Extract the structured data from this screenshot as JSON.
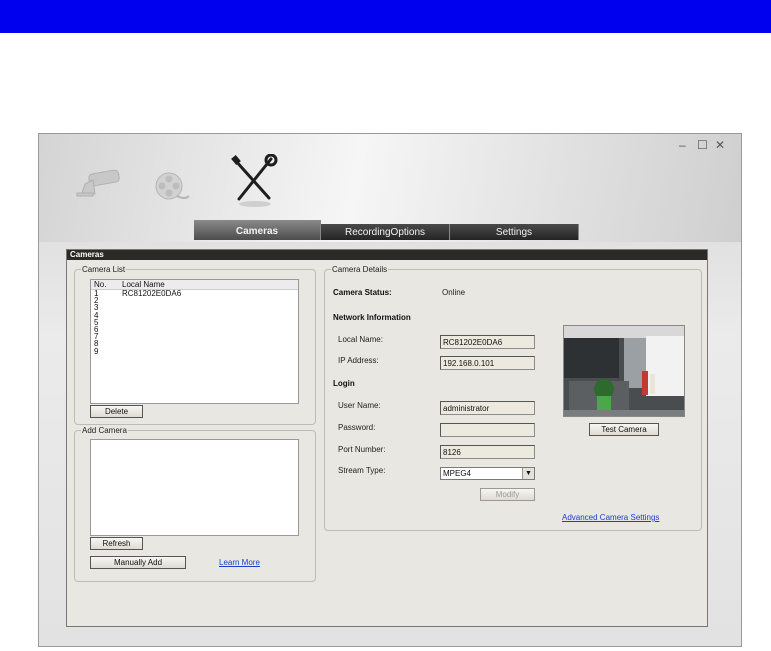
{
  "window_controls": {
    "minimize": "–",
    "maximize": "☐",
    "close": "✕"
  },
  "nav_icons": [
    "camera-icon",
    "film-reel-icon",
    "tools-icon"
  ],
  "tabs": [
    {
      "label": "Cameras",
      "active": true
    },
    {
      "label": "RecordingOptions",
      "active": false
    },
    {
      "label": "Settings",
      "active": false
    }
  ],
  "panel": {
    "title": "Cameras"
  },
  "camera_list": {
    "legend": "Camera List",
    "col_no": "No.",
    "col_name": "Local Name",
    "rows": [
      {
        "no": "1",
        "name": "RC81202E0DA6"
      },
      {
        "no": "2",
        "name": ""
      },
      {
        "no": "3",
        "name": ""
      },
      {
        "no": "4",
        "name": ""
      },
      {
        "no": "5",
        "name": ""
      },
      {
        "no": "6",
        "name": ""
      },
      {
        "no": "7",
        "name": ""
      },
      {
        "no": "8",
        "name": ""
      },
      {
        "no": "9",
        "name": ""
      }
    ],
    "delete_label": "Delete"
  },
  "add_camera": {
    "legend": "Add Camera",
    "refresh_label": "Refresh",
    "manual_add_label": "Manually Add",
    "learn_more_label": "Learn More"
  },
  "details": {
    "legend": "Camera Details",
    "status_label": "Camera Status:",
    "status_value": "Online",
    "network_heading": "Network Information",
    "local_name_label": "Local Name:",
    "local_name_value": "RC81202E0DA6",
    "ip_label": "IP Address:",
    "ip_value": "192.168.0.101",
    "login_heading": "Login",
    "user_label": "User Name:",
    "user_value": "administrator",
    "password_label": "Password:",
    "password_value": "",
    "port_label": "Port Number:",
    "port_value": "8126",
    "stream_label": "Stream Type:",
    "stream_value": "MPEG4",
    "modify_label": "Modify",
    "test_label": "Test Camera",
    "advanced_label": "Advanced Camera Settings"
  }
}
